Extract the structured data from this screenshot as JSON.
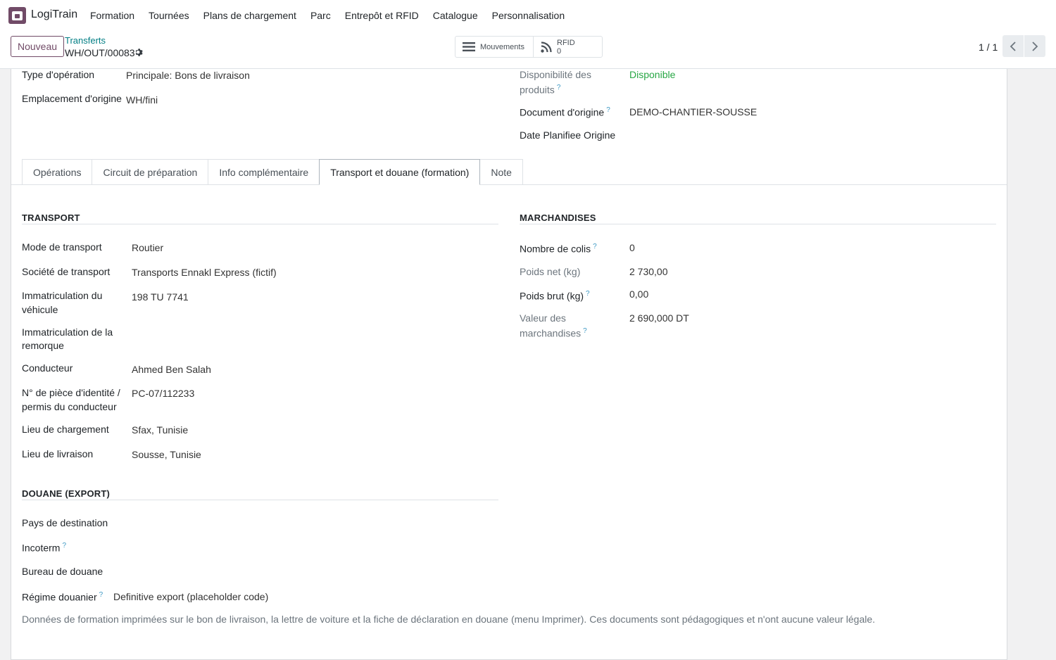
{
  "navbar": {
    "app_name": "LogiTrain",
    "menu": [
      "Formation",
      "Tournées",
      "Plans de chargement",
      "Parc",
      "Entrepôt et RFID",
      "Catalogue",
      "Personnalisation"
    ]
  },
  "control": {
    "new_label": "Nouveau",
    "breadcrumb_parent": "Transferts",
    "breadcrumb_current": "WH/OUT/00083",
    "smart_movements_label": "Mouvements",
    "smart_rfid_label": "RFID",
    "smart_rfid_count": "0",
    "pager_value": "1 / 1"
  },
  "header_fields": {
    "operation_type_label": "Type d'opération",
    "operation_type_value": "Principale: Bons de livraison",
    "source_location_label": "Emplacement d'origine",
    "source_location_value": "WH/fini",
    "availability_label_1": "Disponibilité des",
    "availability_label_2": "produits",
    "availability_value": "Disponible",
    "origin_doc_label": "Document d'origine",
    "origin_doc_value": "DEMO-CHANTIER-SOUSSE",
    "planned_date_label": "Date Planifiee Origine",
    "help_mark": "?"
  },
  "tabs": [
    "Opérations",
    "Circuit de préparation",
    "Info complémentaire",
    "Transport et douane (formation)",
    "Note"
  ],
  "active_tab_index": 3,
  "transport": {
    "title": "TRANSPORT",
    "mode_label": "Mode de transport",
    "mode_value": "Routier",
    "company_label": "Société de transport",
    "company_value": "Transports Ennakl Express (fictif)",
    "vehicle_label_1": "Immatriculation du",
    "vehicle_label_2": "véhicule",
    "vehicle_value": "198 TU 7741",
    "trailer_label_1": "Immatriculation de la",
    "trailer_label_2": "remorque",
    "driver_label": "Conducteur",
    "driver_value": "Ahmed Ben Salah",
    "id_label_1": "N° de pièce d'identité /",
    "id_label_2": "permis du conducteur",
    "id_value": "PC-07/112233",
    "loading_label": "Lieu de chargement",
    "loading_value": "Sfax, Tunisie",
    "delivery_label": "Lieu de livraison",
    "delivery_value": "Sousse, Tunisie"
  },
  "goods": {
    "title": "MARCHANDISES",
    "packages_label": "Nombre de colis",
    "packages_value": "0",
    "net_weight_label": "Poids net (kg)",
    "net_weight_value": "2 730,00",
    "gross_weight_label": "Poids brut (kg)",
    "gross_weight_value": "0,00",
    "goods_value_label_1": "Valeur des",
    "goods_value_label_2": "marchandises",
    "goods_value_value": "2 690,000 DT"
  },
  "customs": {
    "title": "DOUANE (EXPORT)",
    "destination_label": "Pays de destination",
    "incoterm_label": "Incoterm",
    "office_label": "Bureau de douane",
    "regime_label": "Régime douanier",
    "regime_value": "Definitive export (placeholder code)"
  },
  "footer_note": "Données de formation imprimées sur le bon de livraison, la lettre de voiture et la fiche de déclaration en douane (menu Imprimer). Ces documents sont pédagogiques et n'ont aucune valeur légale.",
  "colors": {
    "brand": "#714b67",
    "link": "#017e84",
    "success": "#28a745",
    "help": "#3e99c4"
  }
}
